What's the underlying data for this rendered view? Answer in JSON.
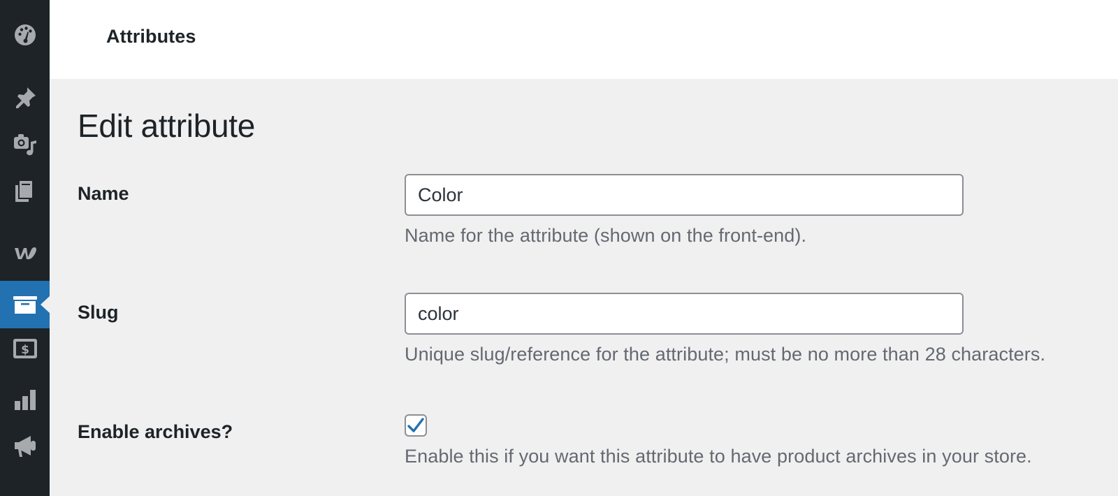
{
  "colors": {
    "sidebar_bg": "#1d2327",
    "sidebar_icon": "#a7aaad",
    "active_bg": "#2271b1",
    "check": "#2271b1"
  },
  "sidebar": {
    "items": [
      {
        "icon": "dashboard-icon",
        "active": false
      },
      {
        "icon": "pin-icon",
        "active": false
      },
      {
        "icon": "media-icon",
        "active": false
      },
      {
        "icon": "pages-icon",
        "active": false
      },
      {
        "icon": "woocommerce-icon",
        "active": false
      },
      {
        "icon": "products-archive-icon",
        "active": true
      },
      {
        "icon": "payments-icon",
        "active": false
      },
      {
        "icon": "analytics-icon",
        "active": false
      },
      {
        "icon": "marketing-megaphone-icon",
        "active": false
      }
    ]
  },
  "header": {
    "title": "Attributes"
  },
  "page": {
    "title": "Edit attribute"
  },
  "form": {
    "name": {
      "label": "Name",
      "value": "Color",
      "description": "Name for the attribute (shown on the front-end)."
    },
    "slug": {
      "label": "Slug",
      "value": "color",
      "description": "Unique slug/reference for the attribute; must be no more than 28 characters."
    },
    "archives": {
      "label": "Enable archives?",
      "checked": true,
      "description": "Enable this if you want this attribute to have product archives in your store."
    }
  }
}
